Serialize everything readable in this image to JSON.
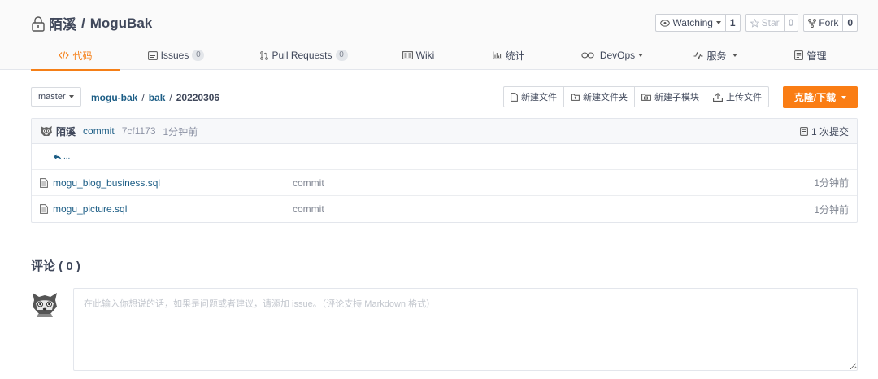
{
  "repo": {
    "owner": "陌溪",
    "separator": "/",
    "name": "MoguBak"
  },
  "actions": {
    "watch": {
      "label": "Watching",
      "count": "1"
    },
    "star": {
      "label": "Star",
      "count": "0"
    },
    "fork": {
      "label": "Fork",
      "count": "0"
    }
  },
  "tabs": [
    {
      "label": "代码",
      "icon": "code-icon",
      "active": true
    },
    {
      "label": "Issues",
      "badge": "0",
      "icon": "issues-icon"
    },
    {
      "label": "Pull Requests",
      "badge": "0",
      "icon": "pull-request-icon"
    },
    {
      "label": "Wiki",
      "icon": "wiki-icon"
    },
    {
      "label": "统计",
      "icon": "stats-icon"
    },
    {
      "label": "DevOps",
      "icon": "devops-icon",
      "dropdown": true
    },
    {
      "label": "服务",
      "icon": "service-icon",
      "dropdown": true
    },
    {
      "label": "管理",
      "icon": "manage-icon"
    }
  ],
  "branch": {
    "name": "master"
  },
  "breadcrumb": {
    "root": "mogu-bak",
    "folder": "bak",
    "current": "20220306",
    "sep": "/"
  },
  "file_actions": {
    "new_file": "新建文件",
    "new_folder": "新建文件夹",
    "new_submodule": "新建子模块",
    "upload": "上传文件"
  },
  "clone": {
    "label": "克隆/下载"
  },
  "last_commit": {
    "author": "陌溪",
    "message": "commit",
    "sha": "7cf1173",
    "time": "1分钟前",
    "count_label": "1 次提交"
  },
  "parent_dir": {
    "label": "..."
  },
  "files": [
    {
      "name": "mogu_blog_business.sql",
      "commit": "commit",
      "time": "1分钟前"
    },
    {
      "name": "mogu_picture.sql",
      "commit": "commit",
      "time": "1分钟前"
    }
  ],
  "comments": {
    "title": "评论 ( 0 )",
    "placeholder": "在此输入你想说的话，如果是问题或者建议，请添加 issue。（评论支持 Markdown 格式）"
  },
  "colors": {
    "accent": "#f57f17",
    "link": "#1d5e86",
    "clone_button": "#fa7d14",
    "text": "#40485b"
  }
}
